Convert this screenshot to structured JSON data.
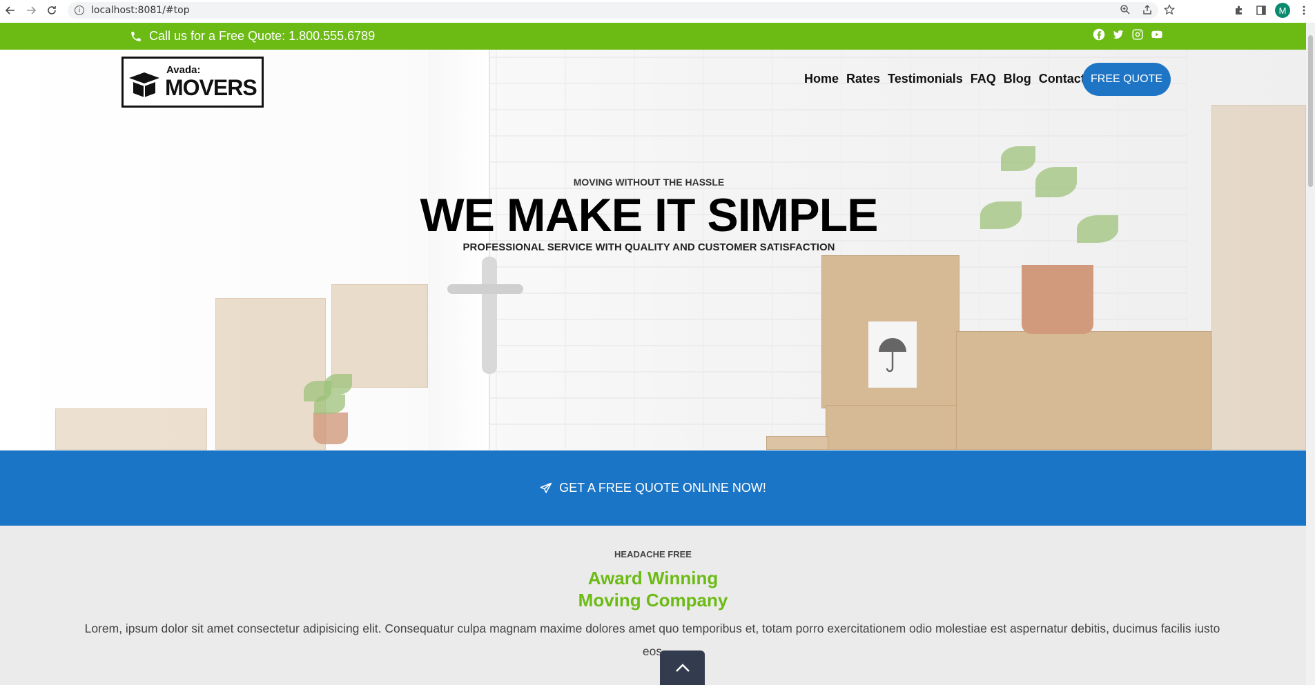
{
  "browser": {
    "url": "localhost:8081/#top",
    "avatar_letter": "M"
  },
  "topbar": {
    "phone_text": "Call us for a Free Quote: 1.800.555.6789",
    "socials": [
      "facebook-icon",
      "twitter-icon",
      "instagram-icon",
      "youtube-icon"
    ],
    "color": "#6cbb15"
  },
  "logo": {
    "small": "Avada:",
    "big": "MOVERS"
  },
  "nav": {
    "items": [
      "Home",
      "Rates",
      "Testimonials",
      "FAQ",
      "Blog",
      "Contact"
    ],
    "cta": "FREE QUOTE"
  },
  "hero": {
    "kicker": "MOVING WITHOUT THE HASSLE",
    "headline": "WE MAKE IT SIMPLE",
    "subline": "PROFESSIONAL SERVICE WITH QUALITY AND CUSTOMER SATISFACTION"
  },
  "band": {
    "text": "GET A FREE QUOTE ONLINE NOW!",
    "color": "#1b75c6"
  },
  "section": {
    "eyebrow": "HEADACHE FREE",
    "title_line1": "Award Winning",
    "title_line2": "Moving Company",
    "body": "Lorem, ipsum dolor sit amet consectetur adipisicing elit. Consequatur culpa magnam maxime dolores amet quo temporibus et, totam porro exercitationem odio molestiae est aspernatur debitis, ducimus facilis iusto eos"
  }
}
